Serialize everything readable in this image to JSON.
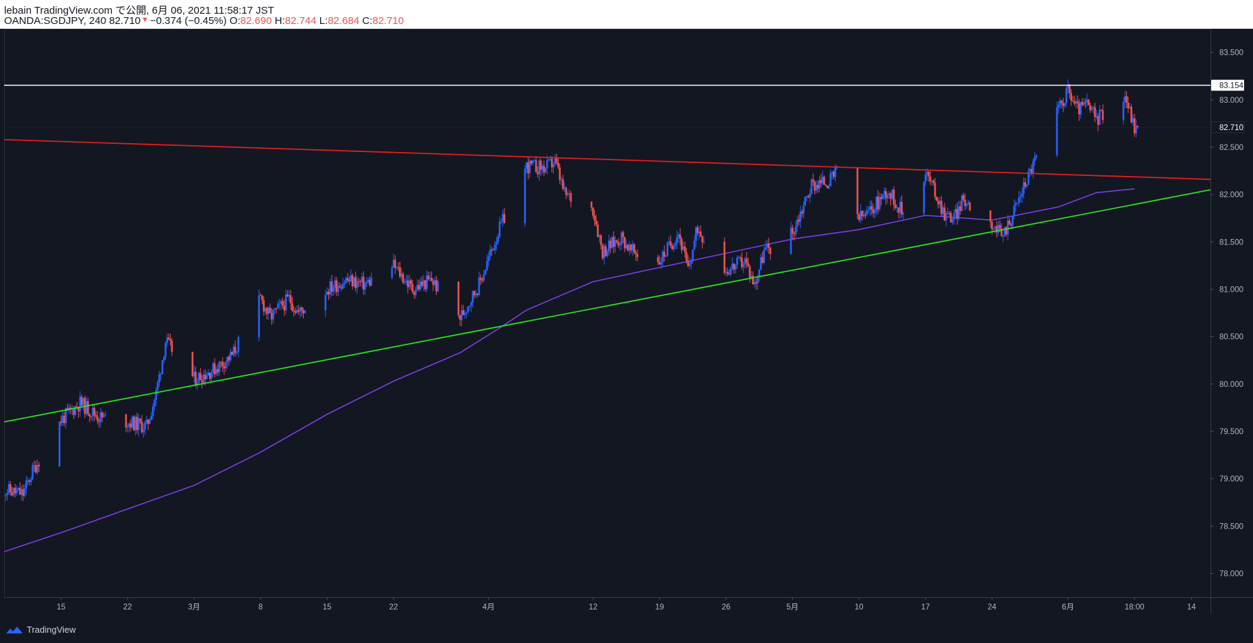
{
  "header": {
    "published": "lebain TradingView.com で公開, 6月 06, 2021 11:58:17 JST",
    "symbol": "OANDA:SGDJPY, 240 82.710",
    "change": "−0.374 (−0.45%)",
    "o_label": "O:",
    "o_value": "82.690",
    "h_label": "H:",
    "h_value": "82.744",
    "l_label": "L:",
    "l_value": "82.684",
    "c_label": "C:",
    "c_value": "82.710"
  },
  "footer": {
    "brand": "TradingView",
    "logo_icon": "tradingview-logo-icon"
  },
  "colors": {
    "background": "#131722",
    "up": "#2962ff",
    "down": "#ef5350",
    "resistance": "#e01f1f",
    "support": "#2be01f",
    "ma": "#7b3fe4",
    "hline": "#ffffff",
    "axis_text": "#b2b5be"
  },
  "chart_data": {
    "type": "candlestick",
    "title": "",
    "yaxis_ticks": [
      "83.500",
      "83.000",
      "82.500",
      "82.000",
      "81.500",
      "81.000",
      "80.500",
      "80.000",
      "79.500",
      "79.000",
      "78.500",
      "78.000"
    ],
    "ylim": [
      77.75,
      83.75
    ],
    "xaxis_ticks": [
      "15",
      "22",
      "3月",
      "8",
      "15",
      "22",
      "4月",
      "12",
      "19",
      "26",
      "5月",
      "10",
      "17",
      "24",
      "6月",
      "18:00",
      "14"
    ],
    "current_price": "82.710",
    "horizontal_level": "83.154",
    "resistance_line": {
      "from": {
        "date": "2021-02-09",
        "value": 82.58
      },
      "to": {
        "date": "2021-06-16",
        "value": 82.16
      }
    },
    "support_line": {
      "from": {
        "date": "2021-02-09",
        "value": 79.6
      },
      "to": {
        "date": "2021-06-16",
        "value": 82.05
      }
    },
    "close_path": [
      [
        "2021-02-09",
        78.88
      ],
      [
        "2021-02-11",
        78.84
      ],
      [
        "2021-02-12",
        79.08
      ],
      [
        "2021-02-15",
        79.62
      ],
      [
        "2021-02-17",
        79.8
      ],
      [
        "2021-02-19",
        79.65
      ],
      [
        "2021-02-22",
        79.6
      ],
      [
        "2021-02-24",
        79.55
      ],
      [
        "2021-02-25",
        79.9
      ],
      [
        "2021-02-26",
        80.45
      ],
      [
        "2021-03-01",
        80.05
      ],
      [
        "2021-03-03",
        80.15
      ],
      [
        "2021-03-05",
        80.3
      ],
      [
        "2021-03-08",
        80.9
      ],
      [
        "2021-03-09",
        80.7
      ],
      [
        "2021-03-11",
        80.9
      ],
      [
        "2021-03-12",
        80.75
      ],
      [
        "2021-03-15",
        81.0
      ],
      [
        "2021-03-17",
        81.1
      ],
      [
        "2021-03-19",
        81.05
      ],
      [
        "2021-03-22",
        81.25
      ],
      [
        "2021-03-24",
        81.0
      ],
      [
        "2021-03-26",
        81.1
      ],
      [
        "2021-03-29",
        80.7
      ],
      [
        "2021-03-31",
        81.05
      ],
      [
        "2021-04-02",
        81.6
      ],
      [
        "2021-04-05",
        82.3
      ],
      [
        "2021-04-07",
        82.28
      ],
      [
        "2021-04-08",
        82.35
      ],
      [
        "2021-04-09",
        82.0
      ],
      [
        "2021-04-12",
        81.85
      ],
      [
        "2021-04-13",
        81.4
      ],
      [
        "2021-04-15",
        81.55
      ],
      [
        "2021-04-16",
        81.4
      ],
      [
        "2021-04-19",
        81.3
      ],
      [
        "2021-04-21",
        81.6
      ],
      [
        "2021-04-22",
        81.2
      ],
      [
        "2021-04-23",
        81.65
      ],
      [
        "2021-04-26",
        81.2
      ],
      [
        "2021-04-28",
        81.3
      ],
      [
        "2021-04-29",
        81.05
      ],
      [
        "2021-04-30",
        81.4
      ],
      [
        "2021-05-03",
        81.6
      ],
      [
        "2021-05-05",
        82.1
      ],
      [
        "2021-05-07",
        82.15
      ],
      [
        "2021-05-08",
        82.28
      ],
      [
        "2021-05-10",
        81.75
      ],
      [
        "2021-05-11",
        81.8
      ],
      [
        "2021-05-13",
        82.05
      ],
      [
        "2021-05-15",
        81.75
      ],
      [
        "2021-05-17",
        82.25
      ],
      [
        "2021-05-19",
        81.8
      ],
      [
        "2021-05-20",
        81.75
      ],
      [
        "2021-05-21",
        81.95
      ],
      [
        "2021-05-24",
        81.7
      ],
      [
        "2021-05-25",
        81.55
      ],
      [
        "2021-05-26",
        81.75
      ],
      [
        "2021-05-27",
        82.0
      ],
      [
        "2021-05-28",
        82.25
      ],
      [
        "2021-05-31",
        82.9
      ],
      [
        "2021-06-01",
        83.1
      ],
      [
        "2021-06-02",
        82.9
      ],
      [
        "2021-06-03",
        82.95
      ],
      [
        "2021-06-04",
        82.8
      ],
      [
        "2021-06-07",
        83.05
      ],
      [
        "2021-06-08",
        82.71
      ]
    ],
    "ma_path": [
      [
        "2021-02-09",
        78.23
      ],
      [
        "2021-02-15",
        78.43
      ],
      [
        "2021-02-22",
        78.68
      ],
      [
        "2021-03-01",
        78.93
      ],
      [
        "2021-03-08",
        79.28
      ],
      [
        "2021-03-15",
        79.68
      ],
      [
        "2021-03-22",
        80.03
      ],
      [
        "2021-03-29",
        80.33
      ],
      [
        "2021-04-02",
        80.58
      ],
      [
        "2021-04-05",
        80.78
      ],
      [
        "2021-04-12",
        81.08
      ],
      [
        "2021-04-19",
        81.23
      ],
      [
        "2021-04-26",
        81.38
      ],
      [
        "2021-05-03",
        81.53
      ],
      [
        "2021-05-10",
        81.63
      ],
      [
        "2021-05-17",
        81.78
      ],
      [
        "2021-05-24",
        81.73
      ],
      [
        "2021-05-31",
        81.87
      ],
      [
        "2021-06-04",
        82.02
      ],
      [
        "2021-06-08",
        82.06
      ]
    ]
  }
}
